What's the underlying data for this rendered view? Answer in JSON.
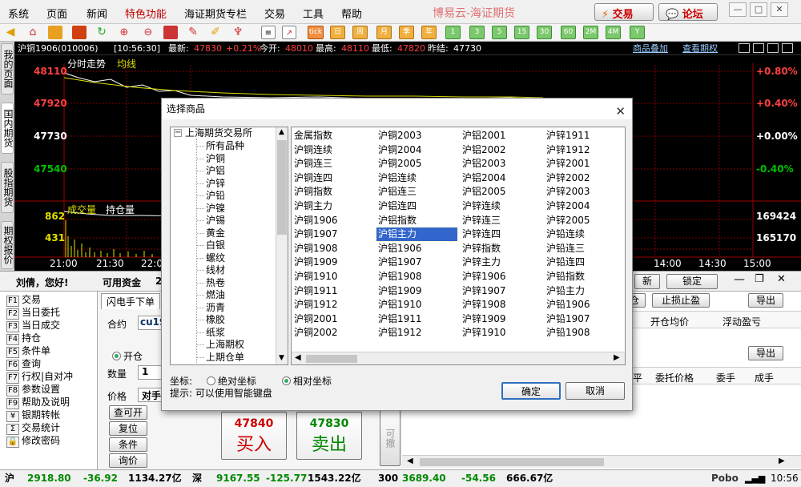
{
  "menu": [
    "系统",
    "页面",
    "新闻",
    "特色功能",
    "海证期货专栏",
    "交易",
    "工具",
    "帮助"
  ],
  "brand": "博易云-海证期货",
  "top_buttons": {
    "trade": "交易",
    "forum": "论坛"
  },
  "toolbar": {
    "period_buttons": [
      "tick",
      "日",
      "周",
      "月",
      "季",
      "年",
      "1",
      "3",
      "5",
      "15",
      "30",
      "60",
      "2M",
      "4M",
      "Y"
    ]
  },
  "chart_header": {
    "contract": "沪铜1906(010006)",
    "time": "[10:56:30]",
    "latest_label": "最新:",
    "latest": "47830",
    "change": "+0.21%",
    "open_label": "今开:",
    "open": "48010",
    "high_label": "最高:",
    "high": "48110",
    "low_label": "最低:",
    "low": "47820",
    "prev_label": "昨结:",
    "prev": "47730",
    "overlay": "商品叠加",
    "view": "查看期权"
  },
  "left_tabs": [
    "我的页面",
    "国内期货",
    "股指期货",
    "期权报价"
  ],
  "chart": {
    "title": "分时走势",
    "avg_label": "均线",
    "price_labels": [
      "48110",
      "47920",
      "47730",
      "47540"
    ],
    "pct_labels": [
      "+0.80%",
      "+0.40%",
      "+0.00%",
      "-0.40%"
    ],
    "volume_title": "成交量",
    "oi_title": "持仓量",
    "volume_labels": [
      "862",
      "431"
    ],
    "oi_labels": [
      "169424",
      "165170"
    ],
    "time_labels": [
      "21:00",
      "21:30",
      "22:0",
      "14:00",
      "14:30",
      "15:00"
    ]
  },
  "trade": {
    "greeting": "刘倩，您好!",
    "funds_label": "可用资金",
    "funds_value": "2",
    "lock": "锁定",
    "stop": "止损止盈",
    "export": "导出",
    "export2": "导出",
    "new_btn": "新",
    "btn2": "仓"
  },
  "left_nav": [
    {
      "key": "F1",
      "label": "交易"
    },
    {
      "key": "F2",
      "label": "当日委托"
    },
    {
      "key": "F3",
      "label": "当日成交"
    },
    {
      "key": "F4",
      "label": "持仓"
    },
    {
      "key": "F5",
      "label": "条件单"
    },
    {
      "key": "F6",
      "label": "查询"
    },
    {
      "key": "F7",
      "label": "行权|自对冲"
    },
    {
      "key": "F8",
      "label": "参数设置"
    },
    {
      "key": "F9",
      "label": "帮助及说明"
    },
    {
      "key": "¥",
      "label": "银期转帐"
    },
    {
      "key": "Σ",
      "label": "交易统计"
    },
    {
      "key": "🔒",
      "label": "修改密码"
    }
  ],
  "order": {
    "tab": "闪电手下单",
    "contract_label": "合约",
    "contract_value": "cu19",
    "open_label": "开仓",
    "qty_label": "数量",
    "qty_value": "1",
    "price_label": "价格",
    "price_value": "对手",
    "buttons": [
      "查可开",
      "复位",
      "条件",
      "询价"
    ],
    "buy_price": "47840",
    "buy_label": "买入",
    "sell_price": "47830",
    "sell_label": "卖出",
    "side_label": "可撤"
  },
  "right_headers": {
    "pos": [
      "开仓均价",
      "浮动盈亏"
    ],
    "orders": [
      "平",
      "委托价格",
      "委手",
      "成手"
    ]
  },
  "status": {
    "sh_label": "沪",
    "sh_value": "2918.80",
    "sh_chg": "-36.92",
    "sh_amt": "1134.27亿",
    "sz_label": "深",
    "sz_value": "9167.55",
    "sz_chg": "-125.77",
    "sz_amt": "1543.22亿",
    "i300_label": "300",
    "i300_value": "3689.40",
    "i300_chg": "-54.56",
    "i300_amt": "666.67亿",
    "brand": "Pobo",
    "time": "10:56"
  },
  "dialog": {
    "title": "选择商品",
    "tree_root": "上海期货交易所",
    "tree_items": [
      "所有品种",
      "沪铜",
      "沪铝",
      "沪锌",
      "沪铅",
      "沪镍",
      "沪锡",
      "黄金",
      "白银",
      "螺纹",
      "线材",
      "热卷",
      "燃油",
      "沥青",
      "橡胶",
      "纸浆",
      "上海期权",
      "上期仓单"
    ],
    "columns": [
      [
        "金属指数",
        "沪铜连续",
        "沪铜连三",
        "沪铜连四",
        "沪铜指数",
        "沪铜主力",
        "沪铜1906",
        "沪铜1907",
        "沪铜1908",
        "沪铜1909",
        "沪铜1910",
        "沪铜1911",
        "沪铜1912",
        "沪铜2001",
        "沪铜2002"
      ],
      [
        "沪铜2003",
        "沪铜2004",
        "沪铜2005",
        "沪铝连续",
        "沪铝连三",
        "沪铝连四",
        "沪铝指数",
        "沪铝主力",
        "沪铝1906",
        "沪铝1907",
        "沪铝1908",
        "沪铝1909",
        "沪铝1910",
        "沪铝1911",
        "沪铝1912"
      ],
      [
        "沪铝2001",
        "沪铝2002",
        "沪铝2003",
        "沪铝2004",
        "沪铝2005",
        "沪锌连续",
        "沪锌连三",
        "沪锌连四",
        "沪锌指数",
        "沪锌主力",
        "沪锌1906",
        "沪锌1907",
        "沪锌1908",
        "沪锌1909",
        "沪锌1910"
      ],
      [
        "沪锌1911",
        "沪锌1912",
        "沪锌2001",
        "沪锌2002",
        "沪锌2003",
        "沪锌2004",
        "沪锌2005",
        "沪铅连续",
        "沪铅连三",
        "沪铅连四",
        "沪铅指数",
        "沪铅主力",
        "沪铅1906",
        "沪铅1907",
        "沪铅1908"
      ]
    ],
    "selected": "沪铝主力",
    "coord_label": "坐标:",
    "coord_abs": "绝对坐标",
    "coord_rel": "相对坐标",
    "hint": "提示: 可以使用智能键盘",
    "ok": "确定",
    "cancel": "取消"
  },
  "colors": {
    "price_up": "#ff3030",
    "price_down": "#00c000",
    "chart_bg": "#000000",
    "price_line": "#ffffff",
    "avg_line": "#e0e000",
    "volume": "#e0e000",
    "selection": "#3366cc"
  }
}
